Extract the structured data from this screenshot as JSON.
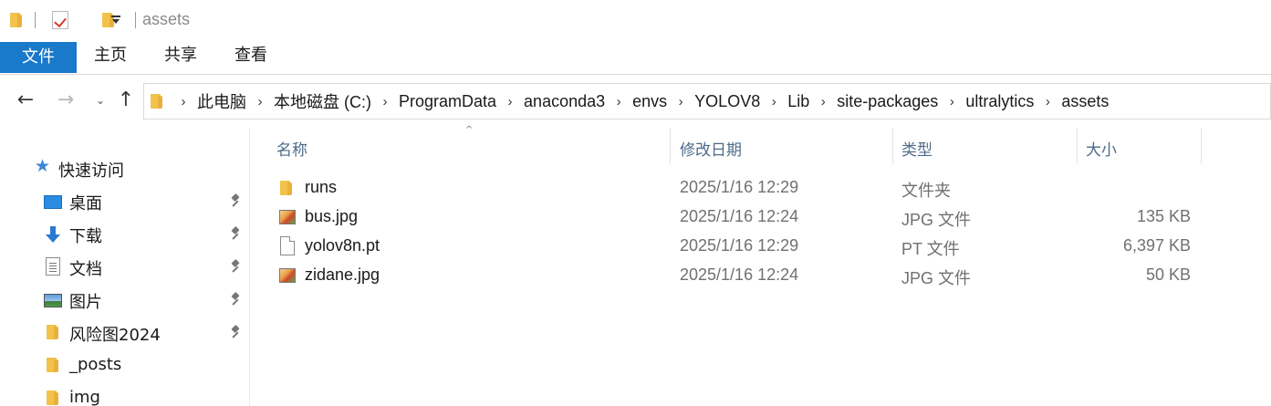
{
  "window": {
    "title": "assets"
  },
  "quick_access_toolbar": {
    "icons": [
      "folder-icon",
      "properties-icon",
      "new-folder-icon",
      "customize-dropdown-icon"
    ]
  },
  "ribbon": {
    "tabs": [
      {
        "label": "文件",
        "active": true
      },
      {
        "label": "主页"
      },
      {
        "label": "共享"
      },
      {
        "label": "查看"
      }
    ],
    "accent_color": "#1979ca"
  },
  "nav": {
    "back_glyph": "←",
    "forward_glyph": "→",
    "recent_glyph": "⌄",
    "up_glyph": "↑",
    "breadcrumb": [
      "此电脑",
      "本地磁盘 (C:)",
      "ProgramData",
      "anaconda3",
      "envs",
      "YOLOV8",
      "Lib",
      "site-packages",
      "ultralytics",
      "assets"
    ],
    "separator": "›"
  },
  "sidebar": {
    "quick_access": {
      "label": "快速访问",
      "icon": "star-icon"
    },
    "items": [
      {
        "label": "桌面",
        "icon": "desktop-icon",
        "pinned": true
      },
      {
        "label": "下载",
        "icon": "download-icon",
        "pinned": true
      },
      {
        "label": "文档",
        "icon": "document-icon",
        "pinned": true
      },
      {
        "label": "图片",
        "icon": "pictures-icon",
        "pinned": true
      },
      {
        "label": "风险图2024",
        "icon": "folder-icon",
        "pinned": true
      },
      {
        "label": "_posts",
        "icon": "folder-icon",
        "pinned": false
      },
      {
        "label": "img",
        "icon": "folder-icon",
        "pinned": false
      }
    ]
  },
  "file_list": {
    "columns": [
      "名称",
      "修改日期",
      "类型",
      "大小"
    ],
    "sort_indicator": "^",
    "rows": [
      {
        "name": "runs",
        "date": "2025/1/16 12:29",
        "type": "文件夹",
        "size": "",
        "icon": "folder-icon"
      },
      {
        "name": "bus.jpg",
        "date": "2025/1/16 12:24",
        "type": "JPG 文件",
        "size": "135 KB",
        "icon": "image-file-icon"
      },
      {
        "name": "yolov8n.pt",
        "date": "2025/1/16 12:29",
        "type": "PT 文件",
        "size": "6,397 KB",
        "icon": "file-icon"
      },
      {
        "name": "zidane.jpg",
        "date": "2025/1/16 12:24",
        "type": "JPG 文件",
        "size": "50 KB",
        "icon": "image-file-icon"
      }
    ]
  }
}
